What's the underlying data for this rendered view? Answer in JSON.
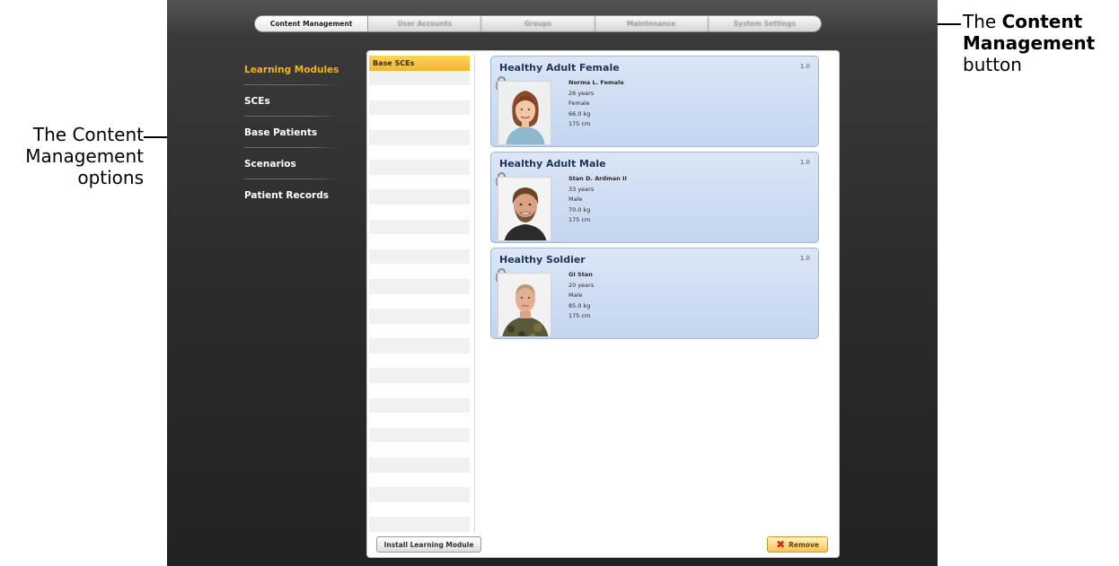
{
  "top_nav": {
    "tabs": [
      {
        "label": "Content Management",
        "active": true
      },
      {
        "label": "User Accounts",
        "active": false
      },
      {
        "label": "Groups",
        "active": false
      },
      {
        "label": "Maintenance",
        "active": false
      },
      {
        "label": "System Settings",
        "active": false
      }
    ]
  },
  "left_menu": {
    "items": [
      {
        "label": "Learning Modules",
        "active": true
      },
      {
        "label": "SCEs",
        "active": false
      },
      {
        "label": "Base Patients",
        "active": false
      },
      {
        "label": "Scenarios",
        "active": false
      },
      {
        "label": "Patient Records",
        "active": false
      }
    ]
  },
  "category_list": {
    "items": [
      "Base SCEs"
    ],
    "selected_index": 0
  },
  "cards": [
    {
      "title": "Healthy Adult Female",
      "version": "1.0",
      "name": "Norma L. Female",
      "age": "26 years",
      "sex": "Female",
      "weight": "66.0 kg",
      "height": "175 cm",
      "icon": "lock-icon",
      "photo": "female-portrait"
    },
    {
      "title": "Healthy Adult Male",
      "version": "1.0",
      "name": "Stan D. Ardman II",
      "age": "33 years",
      "sex": "Male",
      "weight": "70.0 kg",
      "height": "175 cm",
      "icon": "lock-icon",
      "photo": "male-portrait"
    },
    {
      "title": "Healthy Soldier",
      "version": "1.0",
      "name": "GI Stan",
      "age": "20 years",
      "sex": "Male",
      "weight": "85.0 kg",
      "height": "175 cm",
      "icon": "lock-icon",
      "photo": "soldier-portrait"
    }
  ],
  "buttons": {
    "install": "Install Learning Module",
    "remove": "Remove",
    "remove_icon": "x-icon"
  },
  "annotations": {
    "left": "The Content Management options",
    "right_prefix": "The ",
    "right_bold": "Content Management",
    "right_suffix": " button"
  },
  "colors": {
    "accent": "#f3b21f",
    "card_bg": "#c3d5ef",
    "remove_icon": "#d12b1b"
  }
}
